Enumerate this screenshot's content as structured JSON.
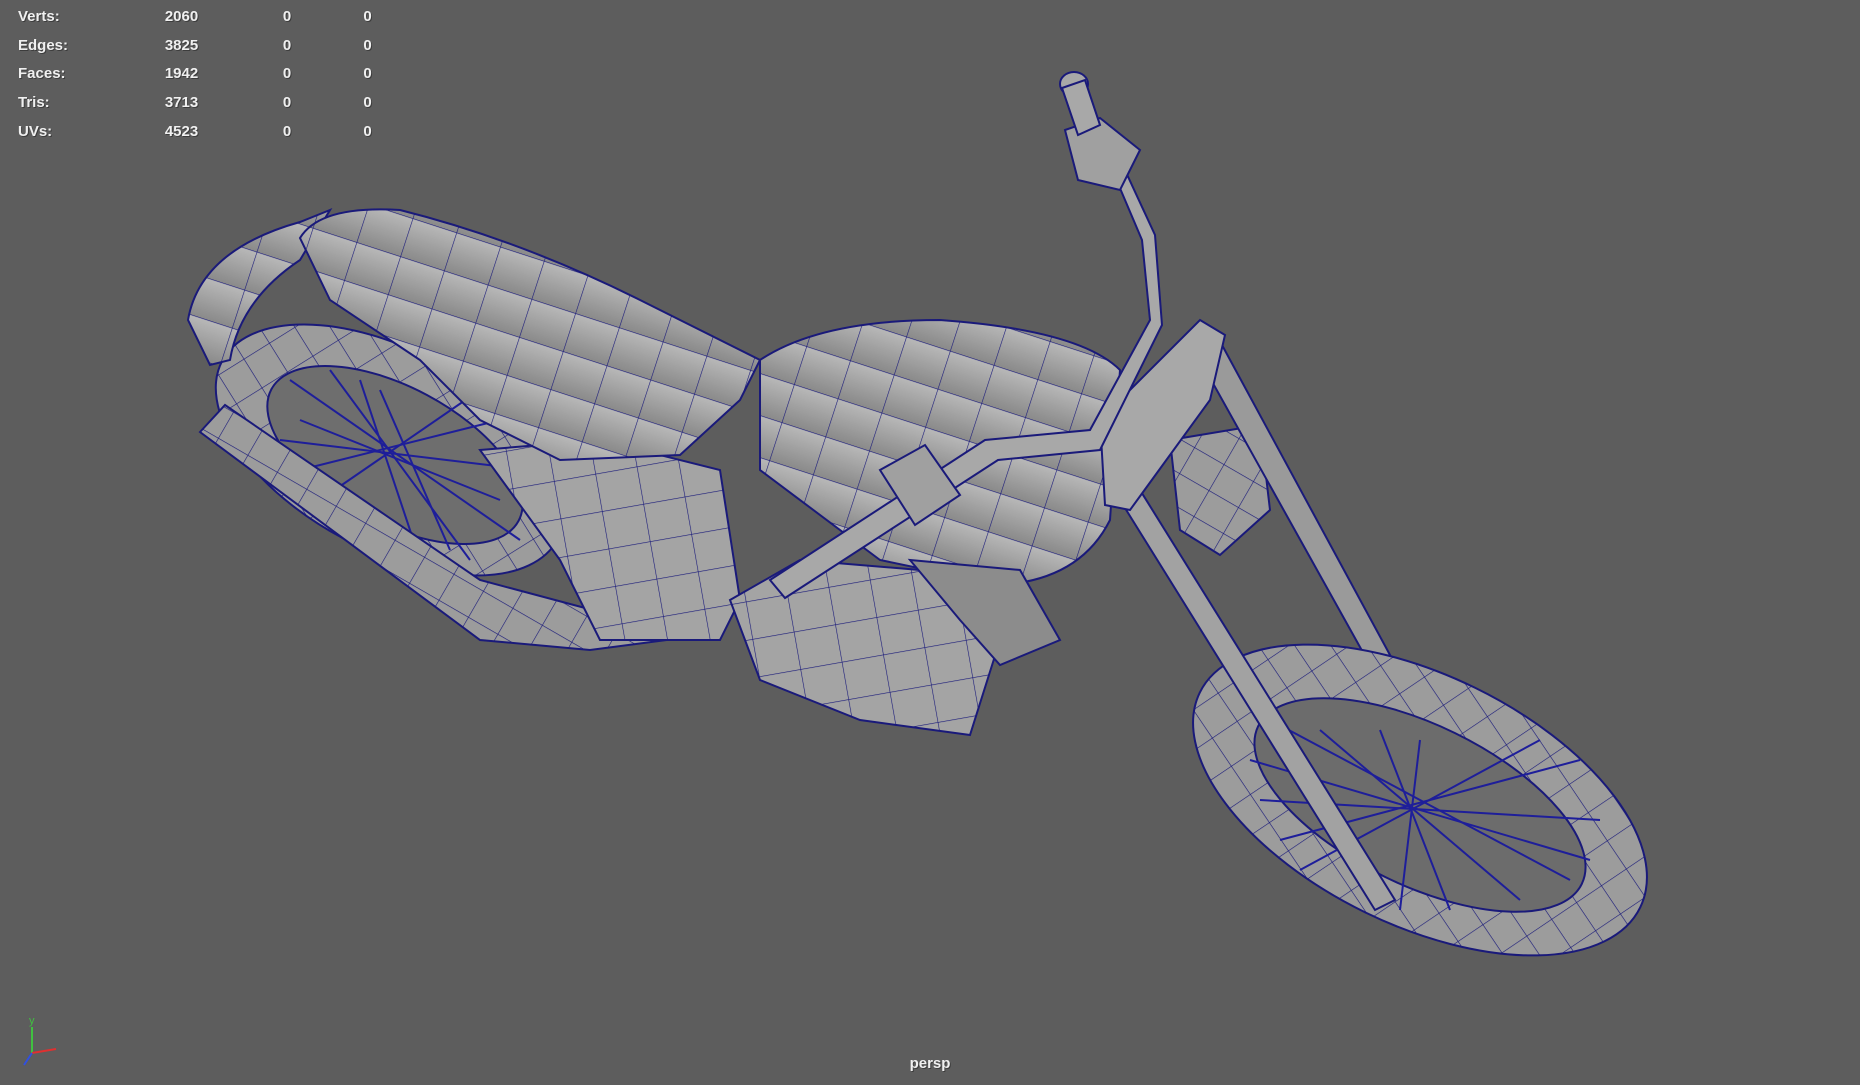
{
  "hud": {
    "rows": [
      {
        "label": "Verts:",
        "value": "2060",
        "selected": "0",
        "components": "0"
      },
      {
        "label": "Edges:",
        "value": "3825",
        "selected": "0",
        "components": "0"
      },
      {
        "label": "Faces:",
        "value": "1942",
        "selected": "0",
        "components": "0"
      },
      {
        "label": "Tris:",
        "value": "3713",
        "selected": "0",
        "components": "0"
      },
      {
        "label": "UVs:",
        "value": "4523",
        "selected": "0",
        "components": "0"
      }
    ]
  },
  "camera": {
    "name": "persp"
  },
  "axis": {
    "y_label": "y",
    "x_color": "#e03030",
    "y_color": "#40c040",
    "z_color": "#3050e0"
  },
  "colors": {
    "background": "#5d5d5d",
    "mesh_fill": "#a9a9a9",
    "wireframe": "#1a1a7a"
  }
}
